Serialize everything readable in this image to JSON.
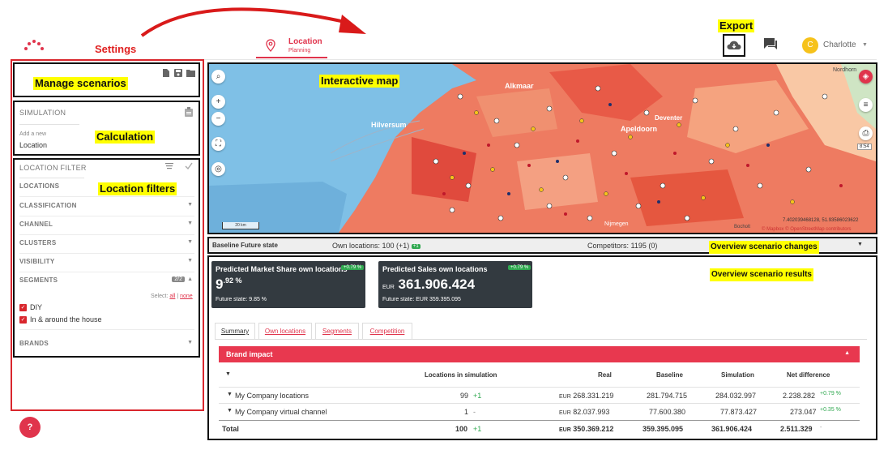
{
  "annotations": {
    "settings": "Settings",
    "export": "Export",
    "manage_scenarios": "Manage scenarios",
    "calculation": "Calculation",
    "location_filters": "Location filters",
    "interactive_map": "Interactive map",
    "overview_changes": "Overview scenario changes",
    "overview_results": "Overview scenario results"
  },
  "header": {
    "nav_title": "Location",
    "nav_subtitle": "Planning",
    "user_initial": "C",
    "user_name": "Charlotte"
  },
  "sidebar": {
    "simulation_title": "SIMULATION",
    "add_new_hint": "Add a new",
    "add_new_value": "Location",
    "filter_title": "LOCATION FILTER",
    "filters": [
      {
        "label": "LOCATIONS"
      },
      {
        "label": "CLASSIFICATION"
      },
      {
        "label": "CHANNEL"
      },
      {
        "label": "CLUSTERS"
      },
      {
        "label": "VISIBILITY"
      },
      {
        "label": "SEGMENTS"
      },
      {
        "label": "BRANDS"
      }
    ],
    "segments_count": "2/2",
    "select_label": "Select:",
    "select_all": "all",
    "select_sep": "|",
    "select_none": "none",
    "segment_options": [
      "DIY",
      "In & around the house"
    ],
    "help_label": "?"
  },
  "map": {
    "places": [
      "Alkmaar",
      "Hilversum",
      "Apeldoorn",
      "Deventer",
      "Nordhorn",
      "Bocholt",
      "Nijmegen"
    ],
    "scale_label": "20 km",
    "coords": "7.402039468128, 51.93586023622",
    "attribution": "© Mapbox © OpenStreetMap contributors",
    "scale_chip": "8:54"
  },
  "changes_bar": {
    "baseline": "Baseline Future state",
    "own_locations": "Own locations: 100 (+1)",
    "own_badge": "+1",
    "competitors": "Competitors: 1195 (0)"
  },
  "kpis": [
    {
      "title": "Predicted Market Share own locations",
      "badge": "+0.79 %",
      "value_main": "9",
      "value_sup": ".92 %",
      "future": "Future state: 9.85 %"
    },
    {
      "title": "Predicted Sales own locations",
      "badge": "+0.79 %",
      "unit": "EUR",
      "value": "361.906.424",
      "future": "Future state: EUR 359.395.095"
    }
  ],
  "tabs": [
    "Summary",
    "Own locations",
    "Segments",
    "Competition"
  ],
  "brand_impact": {
    "title": "Brand impact",
    "columns": [
      "Locations in simulation",
      "Real",
      "Baseline",
      "Simulation",
      "Net difference"
    ],
    "rows": [
      {
        "name": "My Company locations",
        "locations": "99",
        "loc_delta": "+1",
        "real_unit": "EUR",
        "real": "268.331.219",
        "baseline": "281.794.715",
        "simulation": "284.032.997",
        "net": "2.238.282",
        "net_delta": "+0.79 %"
      },
      {
        "name": "My Company virtual channel",
        "locations": "1",
        "loc_delta": "-",
        "real_unit": "EUR",
        "real": "82.037.993",
        "baseline": "77.600.380",
        "simulation": "77.873.427",
        "net": "273.047",
        "net_delta": "+0.35 %"
      },
      {
        "name": "Total",
        "locations": "100",
        "loc_delta": "+1",
        "real_unit": "EUR",
        "real": "350.369.212",
        "baseline": "359.395.095",
        "simulation": "361.906.424",
        "net": "2.511.329",
        "net_delta": "-"
      }
    ]
  },
  "colors": {
    "accent": "#e0344c",
    "dark_card": "#333a40",
    "positive": "#2fa84f",
    "highlight": "#ffff00"
  }
}
